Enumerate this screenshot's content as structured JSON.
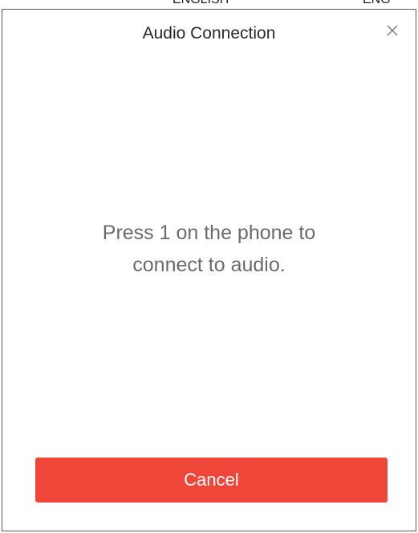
{
  "background_window": {
    "strip_left_text": "ENGLISH",
    "strip_right_text": "ENG"
  },
  "dialog": {
    "title": "Audio Connection",
    "close_icon": "close-icon",
    "message_line1": "Press 1 on the phone to",
    "message_line2": "connect to audio.",
    "cancel_label": "Cancel"
  },
  "colors": {
    "accent": "#f0463a",
    "title_text": "#2a2a2a",
    "message_text": "#6b6b6b",
    "button_text": "#ffffff"
  }
}
